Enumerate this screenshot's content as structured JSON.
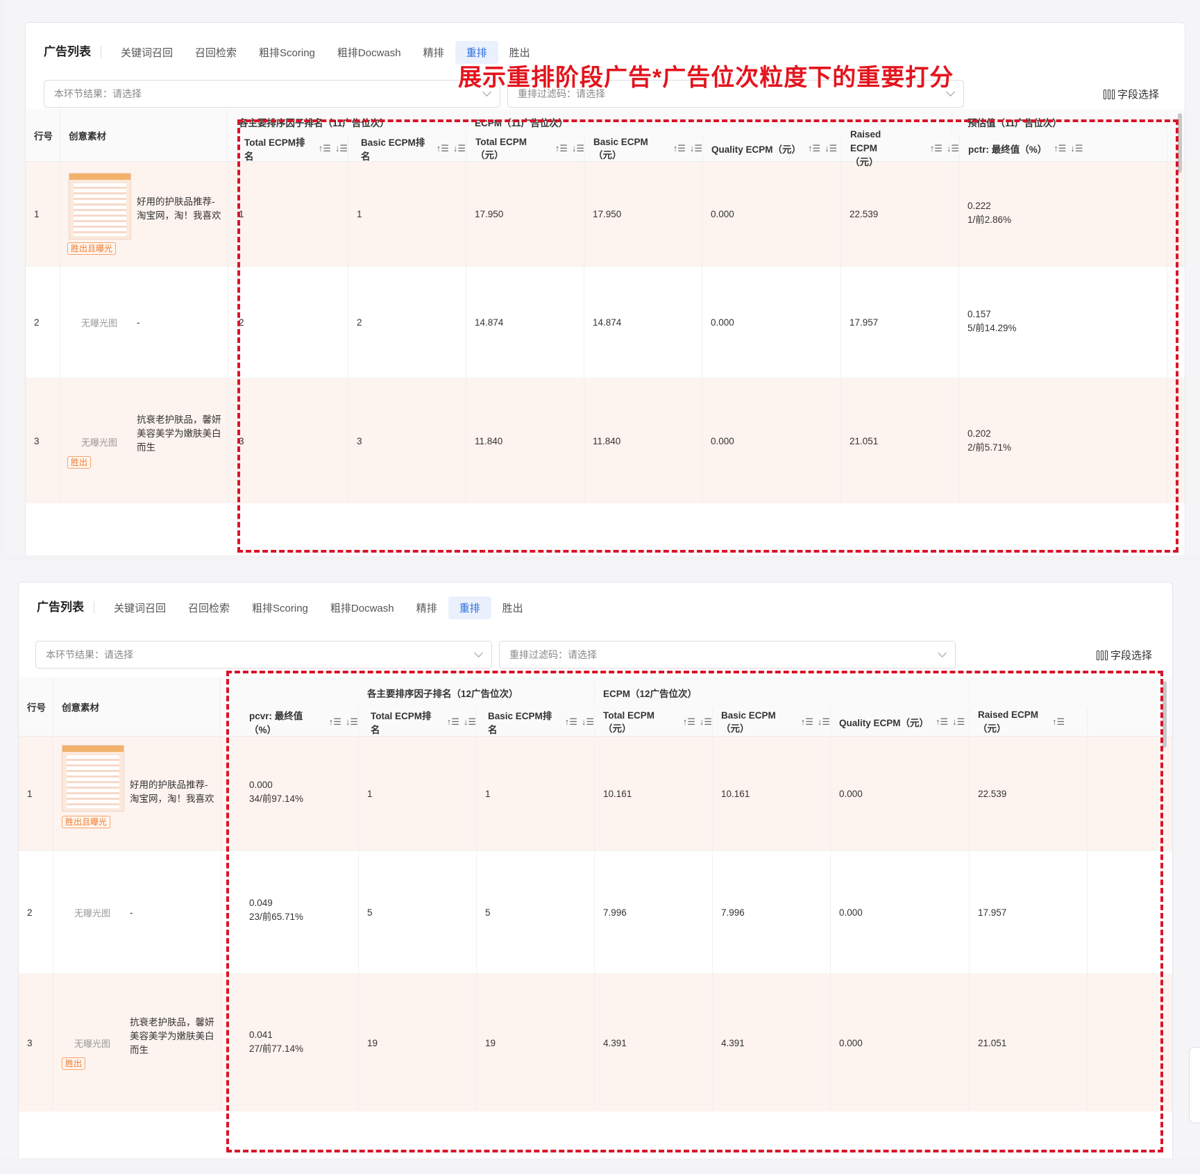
{
  "annotation": "展示重排阶段广告*广告位次粒度下的重要打分",
  "tabs": {
    "title": "广告列表",
    "items": [
      "关键词召回",
      "召回检索",
      "粗排Scoring",
      "粗排Docwash",
      "精排",
      "重排",
      "胜出"
    ],
    "active": "重排"
  },
  "filters": {
    "stage_result": "本环节结果：请选择",
    "rerank_filter": "重排过滤码：请选择",
    "field_select": "字段选择"
  },
  "columns": {
    "row_no": "行号",
    "creative": "创意素材",
    "group_rank_11": "各主要排序因子排名（11广告位次）",
    "group_ecpm_11": "ECPM（11广告位次）",
    "group_pred_11": "预估值（11广告位次）",
    "group_rank_12": "各主要排序因子排名（12广告位次）",
    "group_ecpm_12": "ECPM（12广告位次）",
    "total_ecpm_rank": "Total ECPM排名",
    "basic_ecpm_rank": "Basic ECPM排名",
    "total_ecpm": "Total ECPM（元）",
    "basic_ecpm": "Basic ECPM（元）",
    "quality_ecpm": "Quality ECPM（元）",
    "raised_ecpm_1": "Raised ECPM",
    "raised_ecpm_2": "（元）",
    "pctr": "pctr: 最终值（%）",
    "pcvr": "pcvr: 最终值（%）",
    "sort_asc": "↑☰",
    "sort_desc": "↓☰"
  },
  "rows": [
    {
      "no": "1",
      "tag": "胜出且曝光",
      "image": "thumb",
      "text": [
        "好用的护肤品推荐-",
        "淘宝网，淘！我喜欢"
      ]
    },
    {
      "no": "2",
      "tag": "",
      "image": "无曝光图",
      "text": [
        "-"
      ]
    },
    {
      "no": "3",
      "tag": "胜出",
      "image": "无曝光图",
      "text": [
        "抗衰老护肤品，馨妍",
        "美容美学为嫩肤美白",
        "而生"
      ]
    }
  ],
  "table_top": [
    {
      "total_rank": "1",
      "basic_rank": "1",
      "total_ecpm": "17.950",
      "basic_ecpm": "17.950",
      "quality_ecpm": "0.000",
      "raised_ecpm": "22.539",
      "pctr": "0.222",
      "pctr_rank": "1/前2.86%"
    },
    {
      "total_rank": "2",
      "basic_rank": "2",
      "total_ecpm": "14.874",
      "basic_ecpm": "14.874",
      "quality_ecpm": "0.000",
      "raised_ecpm": "17.957",
      "pctr": "0.157",
      "pctr_rank": "5/前14.29%"
    },
    {
      "total_rank": "3",
      "basic_rank": "3",
      "total_ecpm": "11.840",
      "basic_ecpm": "11.840",
      "quality_ecpm": "0.000",
      "raised_ecpm": "21.051",
      "pctr": "0.202",
      "pctr_rank": "2/前5.71%"
    }
  ],
  "table_bottom": [
    {
      "pcvr": "0.000",
      "pcvr_rank": "34/前97.14%",
      "total_rank": "1",
      "basic_rank": "1",
      "total_ecpm": "10.161",
      "basic_ecpm": "10.161",
      "quality_ecpm": "0.000",
      "raised_ecpm": "22.539"
    },
    {
      "pcvr": "0.049",
      "pcvr_rank": "23/前65.71%",
      "total_rank": "5",
      "basic_rank": "5",
      "total_ecpm": "7.996",
      "basic_ecpm": "7.996",
      "quality_ecpm": "0.000",
      "raised_ecpm": "17.957"
    },
    {
      "pcvr": "0.041",
      "pcvr_rank": "27/前77.14%",
      "total_rank": "19",
      "basic_rank": "19",
      "total_ecpm": "4.391",
      "basic_ecpm": "4.391",
      "quality_ecpm": "0.000",
      "raised_ecpm": "21.051"
    }
  ],
  "colors": {
    "accent": "#2f6fe0",
    "annotation": "#e3141d",
    "row_highlight": "#fdf3ef",
    "tag": "#f07a2c"
  }
}
